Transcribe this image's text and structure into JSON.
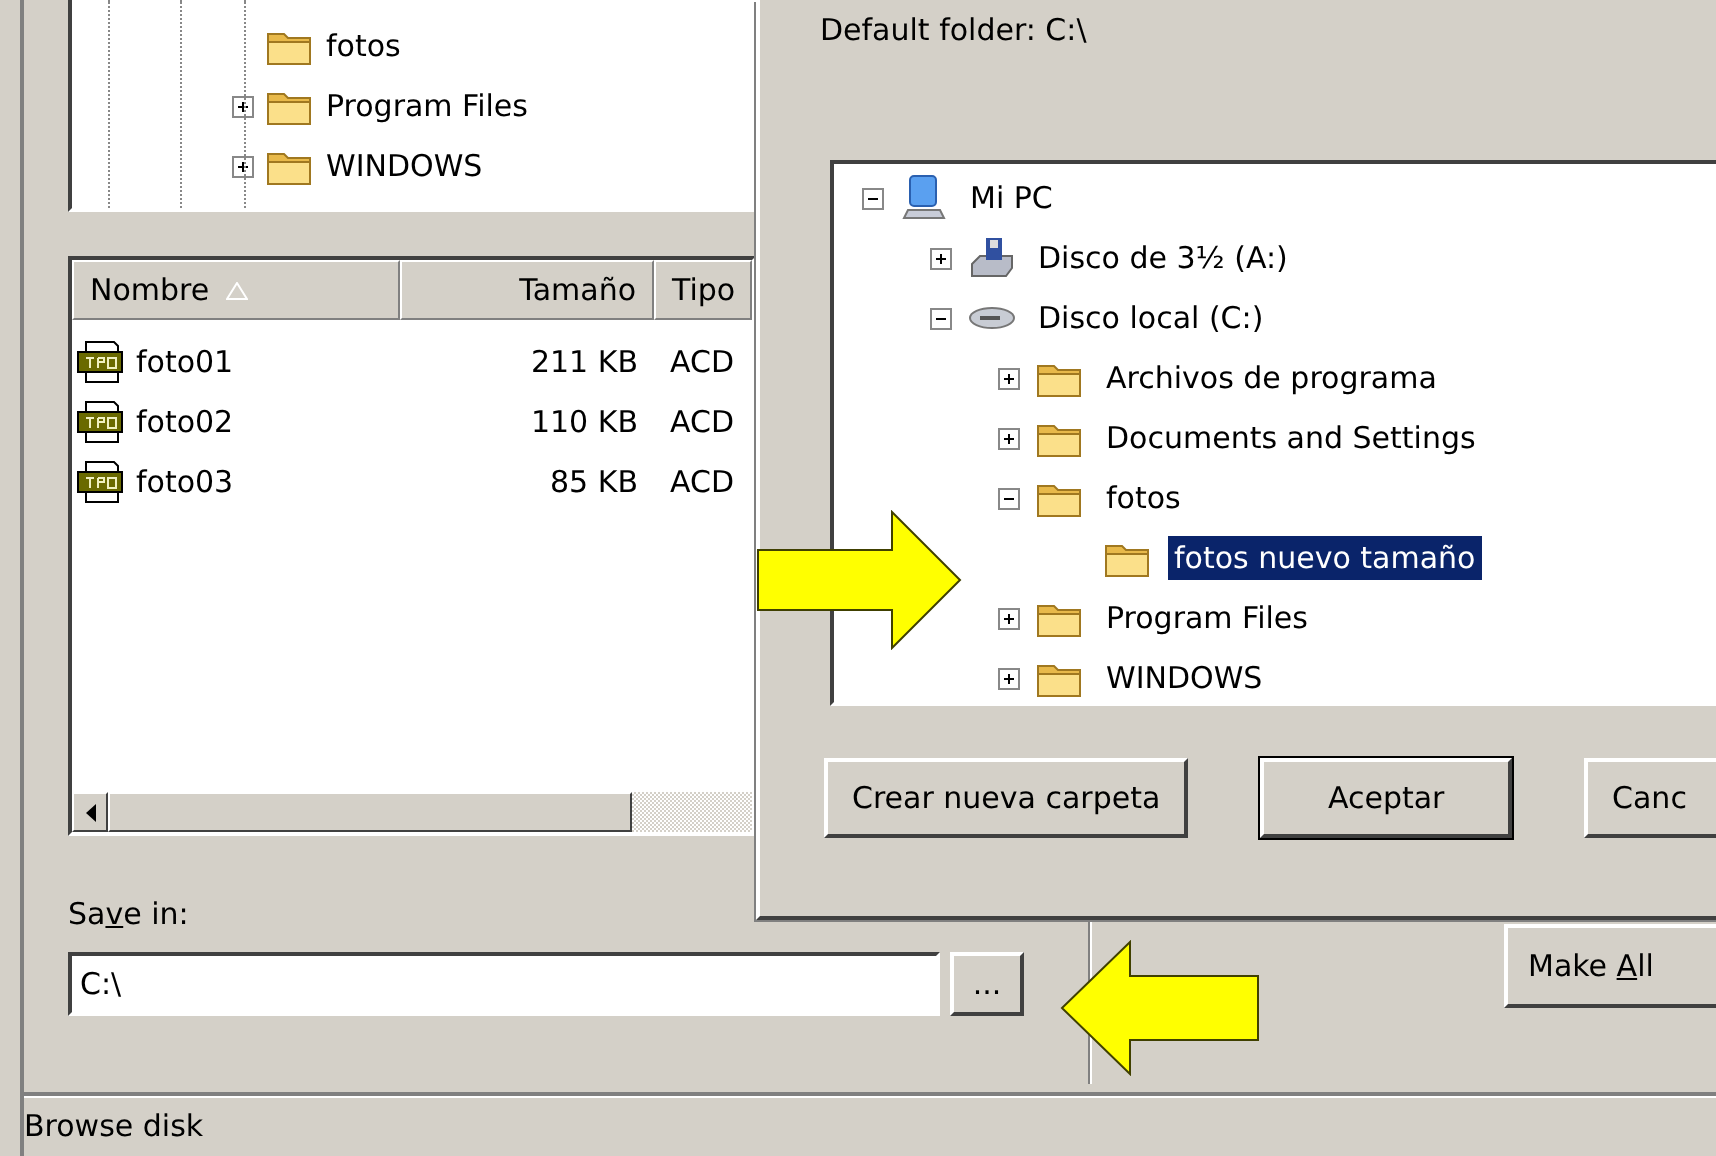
{
  "main_tree": {
    "items": [
      {
        "label": "fotos",
        "expandable": false
      },
      {
        "label": "Program Files",
        "expandable": true
      },
      {
        "label": "WINDOWS",
        "expandable": true
      }
    ]
  },
  "file_list": {
    "columns": [
      {
        "label": "Nombre",
        "sorted": true
      },
      {
        "label": "Tamaño",
        "sorted": false
      },
      {
        "label": "Tipo",
        "sorted": false
      }
    ],
    "rows": [
      {
        "name": "foto01",
        "size": "211 KB",
        "type": "ACD"
      },
      {
        "name": "foto02",
        "size": "110 KB",
        "type": "ACD"
      },
      {
        "name": "foto03",
        "size": "85 KB",
        "type": "ACD"
      }
    ]
  },
  "save_in": {
    "label_parts": [
      "Sa",
      "v",
      "e in:"
    ],
    "value": "C:\\",
    "browse_button": "..."
  },
  "make_all_button": {
    "label_parts": [
      "Make ",
      "A",
      "ll"
    ]
  },
  "status_bar": "Browse disk",
  "dialog": {
    "default_folder": "Default folder: C:\\",
    "tree": [
      {
        "label": "Mi PC",
        "kind": "computer",
        "expandable": true,
        "expanded": true,
        "selected": false,
        "children": [
          {
            "label": "Disco de 3½ (A:)",
            "kind": "floppy",
            "expandable": true,
            "expanded": false,
            "selected": false
          },
          {
            "label": "Disco local (C:)",
            "kind": "drive",
            "expandable": true,
            "expanded": true,
            "selected": false,
            "children": [
              {
                "label": "Archivos de programa",
                "kind": "folder",
                "expandable": true,
                "expanded": false,
                "selected": false
              },
              {
                "label": "Documents and Settings",
                "kind": "folder",
                "expandable": true,
                "expanded": false,
                "selected": false
              },
              {
                "label": "fotos",
                "kind": "folder",
                "expandable": true,
                "expanded": true,
                "selected": false,
                "children": [
                  {
                    "label": "fotos nuevo tamaño",
                    "kind": "folder",
                    "expandable": false,
                    "selected": true
                  }
                ]
              },
              {
                "label": "Program Files",
                "kind": "folder",
                "expandable": true,
                "expanded": false,
                "selected": false
              },
              {
                "label": "WINDOWS",
                "kind": "folder",
                "expandable": true,
                "expanded": false,
                "selected": false
              }
            ]
          }
        ]
      }
    ],
    "buttons": [
      {
        "label": "Crear nueva carpeta",
        "default": false
      },
      {
        "label": "Aceptar",
        "default": true
      },
      {
        "label": "Canc",
        "default": false
      }
    ]
  }
}
